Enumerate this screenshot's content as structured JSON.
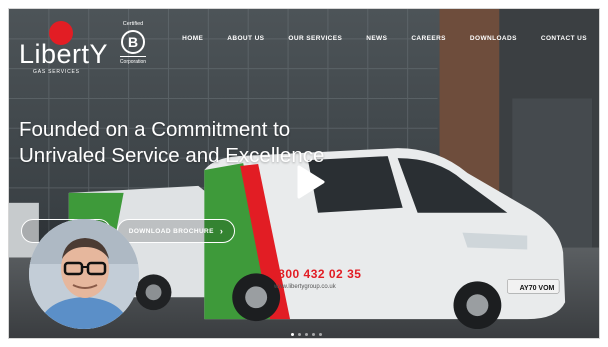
{
  "brand": {
    "name": "LibertY",
    "tagline": "GAS SERVICES",
    "certified_top": "Certified",
    "certified_letter": "B",
    "certified_bottom": "Corporation"
  },
  "nav": {
    "items": [
      "HOME",
      "ABOUT US",
      "OUR SERVICES",
      "NEWS",
      "CAREERS",
      "DOWNLOADS",
      "CONTACT US"
    ]
  },
  "hero": {
    "headline": "Founded on a Commitment to Unrivaled Service and Excellence",
    "button_one": "",
    "button_two": "DOWNLOAD BROCHURE",
    "van_phone": "0800 432 02 35",
    "van_url": "www.libertygroup.co.uk",
    "van_plate": "AY70 VOM",
    "slides_total": 5,
    "slide_active": 1
  },
  "colors": {
    "brand_red": "#e21d24",
    "van_green": "#3e9a3a",
    "van_body": "#e9ebec"
  }
}
